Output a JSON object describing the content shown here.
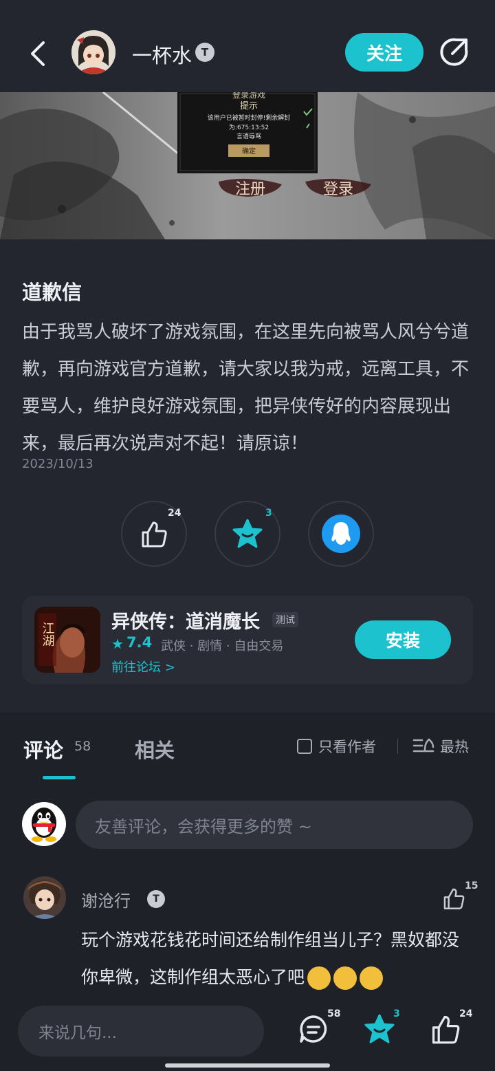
{
  "header": {
    "author_name": "一杯水",
    "badge_text": "T",
    "follow_label": "关注"
  },
  "banner": {
    "dialog_title": "登录游戏",
    "dialog_heading": "提示",
    "dialog_line1": "该用户已被暂时封停!剩余解封",
    "dialog_line2": "为:675:13:52",
    "dialog_line3": "言语辱骂",
    "dialog_confirm": "确定",
    "btn_register": "注册",
    "btn_login": "登录"
  },
  "post": {
    "title": "道歉信",
    "body": "由于我骂人破坏了游戏氛围，在这里先向被骂人风兮兮道歉，再向游戏官方道歉，请大家以我为戒，远离工具，不要骂人，维护良好游戏氛围，把异侠传好的内容展现出来，最后再次说声对不起！请原谅！",
    "date": "2023/10/13",
    "like_count": "24",
    "favorite_count": "3"
  },
  "game": {
    "name": "异侠传：道消魔长",
    "tag": "测试",
    "rating": "7.4",
    "categories": "武侠 · 剧情 · 自由交易",
    "forum_link": "前往论坛 >",
    "install_label": "安装",
    "icon_text": "江湖"
  },
  "tabs": {
    "comments_label": "评论",
    "comments_count": "58",
    "related_label": "相关",
    "only_author_label": "只看作者",
    "sort_label": "最热"
  },
  "comment_input": {
    "placeholder": "友善评论，会获得更多的赞 ~"
  },
  "comments": [
    {
      "author": "谢沧行",
      "badge": "T",
      "likes": "15",
      "text": "玩个游戏花钱花时间还给制作组当儿子？黑奴都没你卑微，这制作组太恶心了吧"
    }
  ],
  "bottom_bar": {
    "input_placeholder": "来说几句...",
    "comment_count": "58",
    "favorite_count": "3",
    "like_count": "24"
  },
  "colors": {
    "accent": "#1cc3cf",
    "background": "#1f2128",
    "card": "#23262e"
  }
}
